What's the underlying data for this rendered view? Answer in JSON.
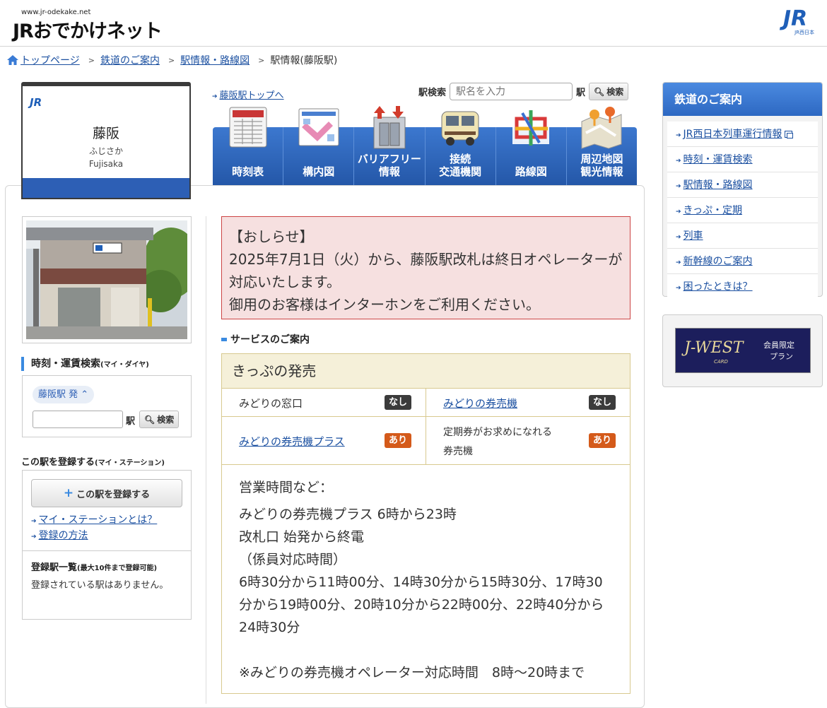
{
  "header": {
    "site_url": "www.jr-odekake.net",
    "site_name": "JRおでかけネット",
    "jr_logo_text": "JR",
    "jr_logo_sub": "JR西日本"
  },
  "breadcrumb": {
    "items": [
      "トップページ",
      "鉄道のご案内",
      "駅情報・路線図"
    ],
    "current": "駅情報(藤阪駅)",
    "separator": ">"
  },
  "station": {
    "logo_text": "JR",
    "name": "藤阪",
    "kana": "ふじさか",
    "roman": "Fujisaka"
  },
  "top_link": "藤阪駅トップへ",
  "search": {
    "label": "駅検索",
    "placeholder": "駅名を入力",
    "suffix": "駅",
    "button": "検索"
  },
  "nav": [
    {
      "label": "時刻表",
      "icon": "timetable-icon"
    },
    {
      "label": "構内図",
      "icon": "floor-map-icon"
    },
    {
      "label": "バリアフリー\n情報",
      "icon": "elevator-icon"
    },
    {
      "label": "接続\n交通機関",
      "icon": "bus-icon"
    },
    {
      "label": "路線図",
      "icon": "route-map-icon"
    },
    {
      "label": "周辺地図\n観光情報",
      "icon": "area-map-icon"
    }
  ],
  "fare_search": {
    "title": "時刻・運賃検索",
    "subtitle": "(マイ・ダイヤ)",
    "from_label": "藤阪駅 発",
    "suffix": "駅",
    "button": "検索"
  },
  "register": {
    "title": "この駅を登録する",
    "subtitle": "(マイ・ステーション)",
    "button": "この駅を登録する",
    "link_what": "マイ・ステーションとは？",
    "link_how": "登録の方法",
    "list_title": "登録駅一覧",
    "list_note": "(最大10件まで登録可能)",
    "empty_text": "登録されている駅はありません。"
  },
  "notice": {
    "title": "【おしらせ】",
    "body": "2025年7月1日（火）から、藤阪駅改札は終日オペレーターが対応いたします。",
    "body2": "御用のお客様はインターホンをご利用ください。"
  },
  "services": {
    "title": "サービスのご案内",
    "ticket_heading": "きっぷの発売",
    "rows": [
      [
        {
          "label": "みどりの窓口",
          "link": false,
          "status": "なし",
          "kind": "none"
        },
        {
          "label": "みどりの券売機",
          "link": true,
          "status": "なし",
          "kind": "none"
        }
      ],
      [
        {
          "label": "みどりの券売機プラス",
          "link": true,
          "status": "あり",
          "kind": "yes"
        },
        {
          "label": "定期券がお求めになれる\n券売機",
          "link": false,
          "status": "あり",
          "kind": "yes"
        }
      ]
    ],
    "hours": [
      "営業時間など：",
      "みどりの券売機プラス 6時から23時",
      "改札口 始発から終電",
      "（係員対応時間）",
      "6時30分から11時00分、14時30分から15時30分、17時30分から19時00分、20時10分から22時00分、22時40分から24時30分",
      "",
      "※みどりの券売機オペレーター対応時間　8時～20時まで"
    ]
  },
  "rail_menu": {
    "title": "鉄道のご案内",
    "items": [
      "JR西日本列車運行情報",
      "時刻・運賃検索",
      "駅情報・路線図",
      "きっぷ・定期",
      "列車",
      "新幹線のご案内",
      "困ったときは？"
    ]
  },
  "banner": {
    "logo": "J-WEST",
    "card": "CARD",
    "promo_line1": "会員限定",
    "promo_line2": "プラン"
  },
  "colors": {
    "nav_blue": "#2d5fb5",
    "link": "#1a4fa0",
    "notice_bg": "#f6e0e0",
    "badge_none": "#3b3b3b",
    "badge_yes": "#d45a1a"
  }
}
